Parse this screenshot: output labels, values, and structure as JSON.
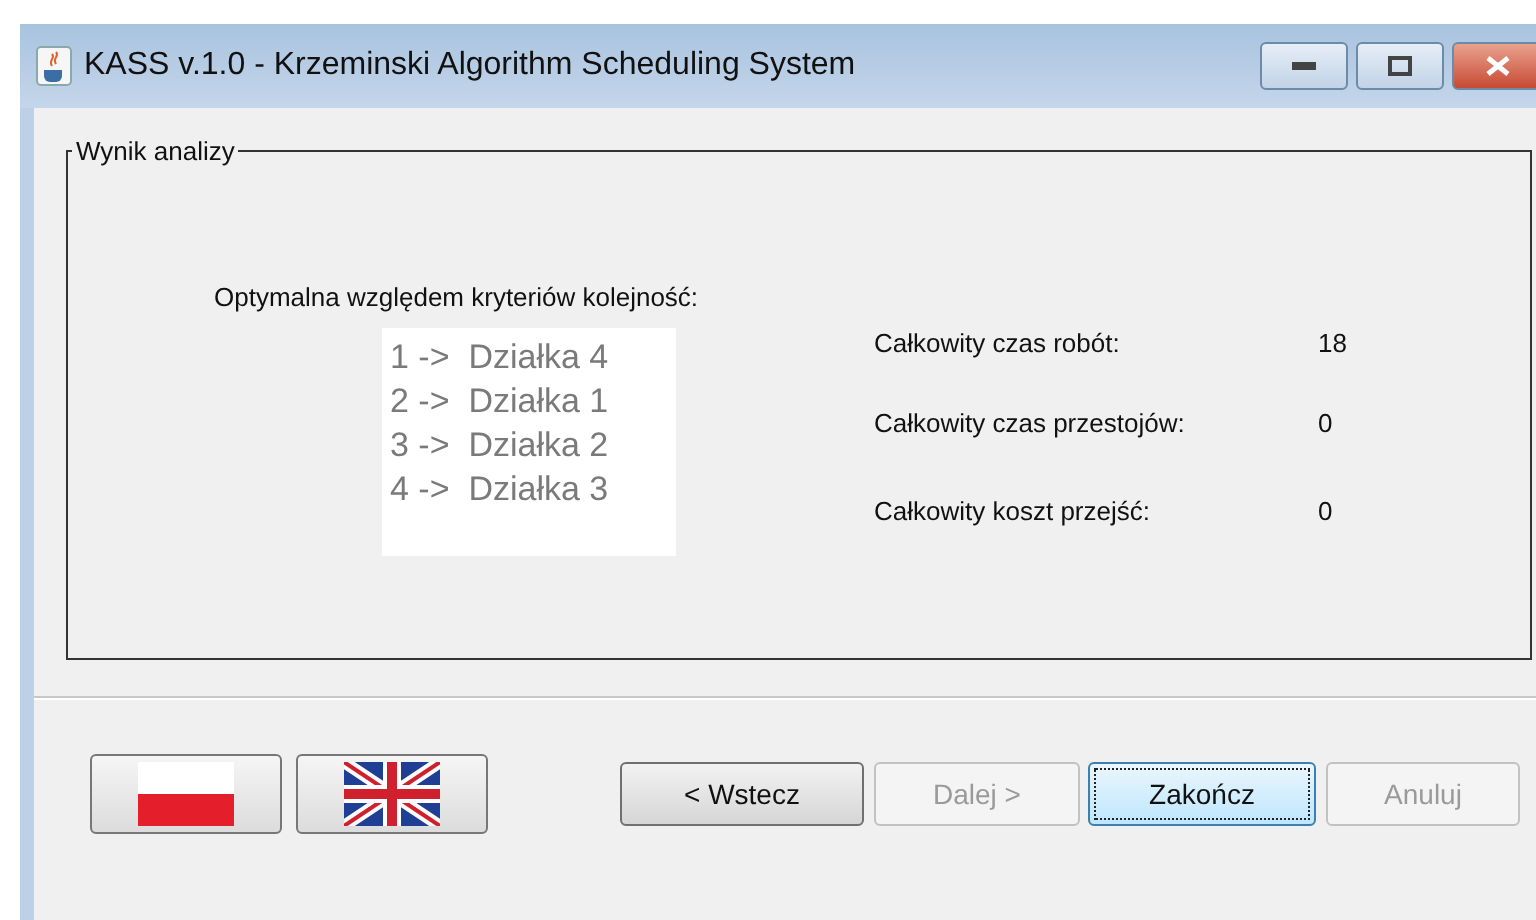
{
  "window": {
    "title": "KASS v.1.0 - Krzeminski Algorithm Scheduling System"
  },
  "group": {
    "title": "Wynik analizy",
    "heading": "Optymalna względem kryteriów kolejność:",
    "order": [
      "1 ->  Działka 4",
      "2 ->  Działka 1",
      "3 ->  Działka 2",
      "4 ->  Działka 3"
    ],
    "stats": [
      {
        "label": "Całkowity czas robót:",
        "value": "18"
      },
      {
        "label": "Całkowity czas przestojów:",
        "value": "0"
      },
      {
        "label": "Całkowity koszt przejść:",
        "value": "0"
      }
    ]
  },
  "languages": [
    {
      "kind": "poland"
    },
    {
      "kind": "uk"
    }
  ],
  "buttons": [
    {
      "label": "< Wstecz",
      "disabled": false,
      "focused": false
    },
    {
      "label": "Dalej >",
      "disabled": true,
      "focused": false
    },
    {
      "label": "Zakończ",
      "disabled": false,
      "focused": true
    },
    {
      "label": "Anuluj",
      "disabled": true,
      "focused": false
    }
  ]
}
